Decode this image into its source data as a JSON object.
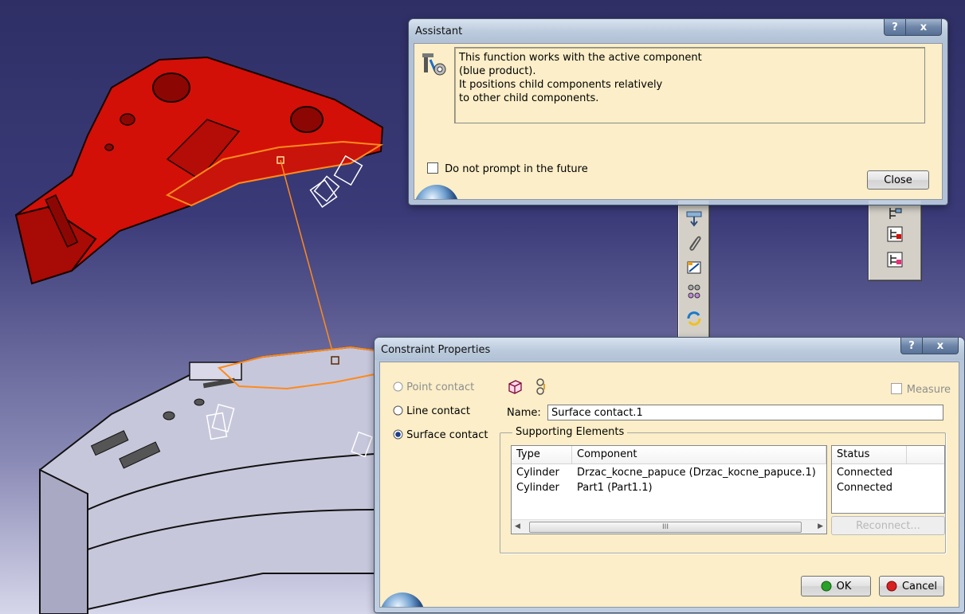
{
  "assistant": {
    "title": "Assistant",
    "help_label": "?",
    "close_x": "x",
    "message_lines": [
      "This function works with the active component",
      "(blue product).",
      "It positions child components relatively",
      "to other child components."
    ],
    "dont_prompt_label": "Do not prompt in the future",
    "close_button": "Close"
  },
  "constraint": {
    "title": "Constraint Properties",
    "help_label": "?",
    "close_x": "x",
    "options": [
      {
        "label": "Point contact",
        "enabled": false,
        "selected": false
      },
      {
        "label": "Line contact",
        "enabled": true,
        "selected": false
      },
      {
        "label": "Surface contact",
        "enabled": true,
        "selected": true
      }
    ],
    "measure_label": "Measure",
    "name_label": "Name:",
    "name_value": "Surface contact.1",
    "supporting_label": "Supporting Elements",
    "headers": {
      "type": "Type",
      "component": "Component",
      "status": "Status"
    },
    "rows": [
      {
        "type": "Cylinder",
        "component": "Drzac_kocne_papuce (Drzac_kocne_papuce.1)",
        "status": "Connected"
      },
      {
        "type": "Cylinder",
        "component": "Part1 (Part1.1)",
        "status": "Connected"
      }
    ],
    "scroll_mid": "III",
    "reconnect_label": "Reconnect...",
    "ok_label": "OK",
    "cancel_label": "Cancel"
  },
  "toolbars": {
    "left_icons": [
      "reorder-down-icon",
      "paperclip-icon",
      "snap-constraint-icon",
      "fix-together-icon",
      "update-icon"
    ],
    "right_icons": [
      "product-tree-icon",
      "product-tree-red-icon",
      "product-tree-gray-icon"
    ]
  },
  "colors": {
    "bg_top": "#2f2f66",
    "red_part": "#d21008",
    "gray_part": "#c7c7dc",
    "orange_highlight": "#ff8a1c",
    "dialog_client": "#fbeec8"
  }
}
